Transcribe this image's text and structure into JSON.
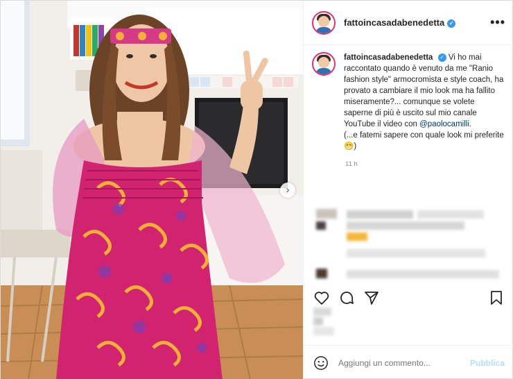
{
  "post": {
    "username": "fattoincasadabenedetta",
    "verified_badge": "✓",
    "more_icon": "more-horizontal-icon",
    "more_label": "•••",
    "caption": {
      "username": "fattoincasadabenedetta",
      "text_1": "Vi ho mai raccontato quando è venuto da me \"Ranio fashion style\" armocromista e style coach, ha provato a cambiare il mio look ma ha fallito miseramente?... comunque se volete saperne di più è uscito sul mio canale YouTube il video con ",
      "mention": "@paolocamilli",
      "text_2": ".",
      "text_3": "(...e fatemi sapere con quale look mi preferite 😁)"
    },
    "time_ago": "11 h",
    "next_label": "›",
    "actions": {
      "like_icon": "heart-icon",
      "comment_icon": "comment-icon",
      "share_icon": "send-icon",
      "save_icon": "bookmark-icon"
    },
    "add_comment": {
      "emoji_icon": "smiley-icon",
      "placeholder": "Aggiungi un commento...",
      "publish_label": "Pubblica"
    },
    "colors": {
      "accent": "#3897f0",
      "publish_disabled": "#b2dffc",
      "story_ring": "#e1306c",
      "dress_pink": "#d1236f"
    }
  }
}
